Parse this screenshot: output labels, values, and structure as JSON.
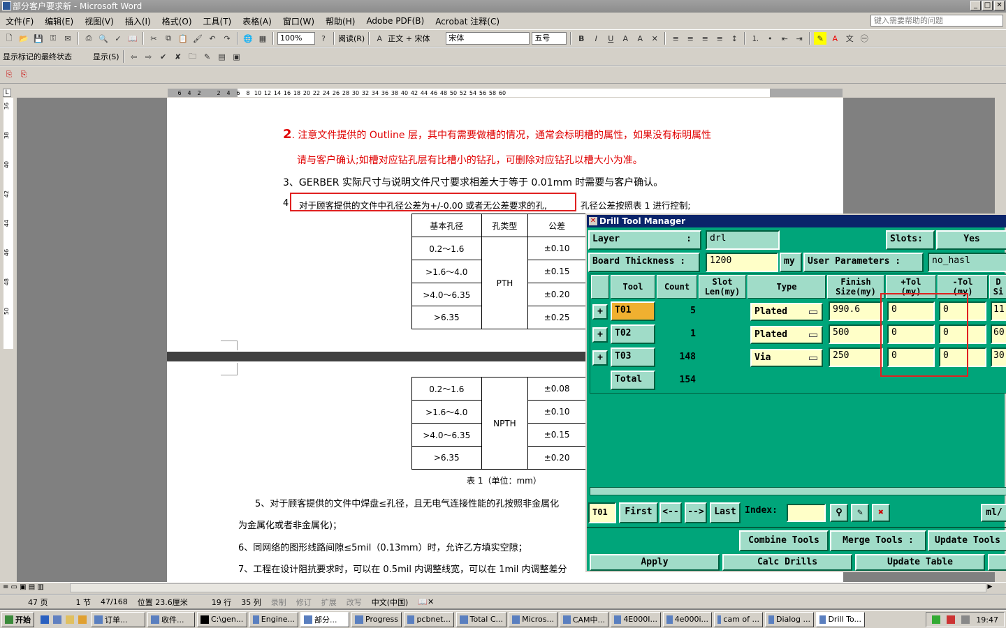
{
  "window": {
    "title": "部分客户要求新 - Microsoft Word"
  },
  "menu": [
    "文件(F)",
    "编辑(E)",
    "视图(V)",
    "插入(I)",
    "格式(O)",
    "工具(T)",
    "表格(A)",
    "窗口(W)",
    "帮助(H)",
    "Adobe PDF(B)",
    "Acrobat 注释(C)"
  ],
  "help_placeholder": "键入需要帮助的问题",
  "toolbar": {
    "zoom": "100%",
    "read_label": "阅读(R)",
    "style": "正文 + 宋体",
    "font": "宋体",
    "size": "五号"
  },
  "toolbar2": {
    "markup_state": "显示标记的最终状态",
    "show_label": "显示(S)"
  },
  "ruler": {
    "h_ticks": [
      "6",
      "4",
      "2",
      "",
      "2",
      "4",
      "6",
      "8",
      "10",
      "12",
      "14",
      "16",
      "18",
      "20",
      "22",
      "24",
      "26",
      "28",
      "30",
      "32",
      "34",
      "36",
      "38",
      "40",
      "42",
      "44",
      "46",
      "48",
      "50",
      "52",
      "54",
      "56",
      "58",
      "60"
    ],
    "v_ticks": [
      "36",
      "38",
      "40",
      "42",
      "44",
      "46",
      "48",
      "50"
    ]
  },
  "doc": {
    "item2_num": "2",
    "item2_line1": ". 注意文件提供的 Outline 层，其中有需要做槽的情况，通常会标明槽的属性，如果没有标明属性",
    "item2_line2": "请与客户确认;如槽对应钻孔层有比槽小的钻孔，可删除对应钻孔以槽大小为准。",
    "item3": "3、GERBER 实际尺寸与说明文件尺寸要求相差大于等于 0.01mm 时需要与客户确认。",
    "item4_num": "4",
    "item4_boxed": "对于顾客提供的文件中孔径公差为+/-0.00 或者无公差要求的孔,",
    "item4_rest": "孔径公差按照表 1 进行控制;",
    "table_headers": [
      "基本孔径",
      "孔类型",
      "公差"
    ],
    "pth_rows": [
      [
        "0.2～1.6",
        "±0.10"
      ],
      [
        ">1.6～4.0",
        "±0.15"
      ],
      [
        ">4.0～6.35",
        "±0.20"
      ],
      [
        ">6.35",
        "±0.25"
      ]
    ],
    "pth_label": "PTH",
    "npth_rows": [
      [
        "0.2～1.6",
        "±0.08"
      ],
      [
        ">1.6～4.0",
        "±0.10"
      ],
      [
        ">4.0～6.35",
        "±0.15"
      ],
      [
        ">6.35",
        "±0.20"
      ]
    ],
    "npth_label": "NPTH",
    "caption": "表 1（单位：mm）",
    "item5_line1": "5、对于顾客提供的文件中焊盘≤孔径，且无电气连接性能的孔按照非金属化",
    "item5_line2": "为金属化或者非金属化)；",
    "item6": "6、同网络的图形线路间隙≤5mil（0.13mm）时，允许乙方填实空隙；",
    "item7": "7、工程在设计阻抗要求时，可以在 0.5mil 内调整线宽，可以在 1mil 内调整差分"
  },
  "status": {
    "page": "47 页",
    "section": "1 节",
    "page_of": "47/168",
    "position": "位置 23.6厘米",
    "line": "19 行",
    "col": "35 列",
    "rec": "录制",
    "trk": "修订",
    "ext": "扩展",
    "ovr": "改写",
    "lang": "中文(中国)"
  },
  "taskbar": {
    "start": "开始",
    "items": [
      "订单...",
      "收件...",
      "C:\\gen...",
      "Engine...",
      "部分...",
      "Progress",
      "pcbnet...",
      "Total C...",
      "Micros...",
      "CAM中...",
      "4E000I...",
      "4e000i...",
      "cam of ...",
      "Dialog ...",
      "Drill To..."
    ],
    "clock": "19:47"
  },
  "dtm": {
    "title": "Drill Tool Manager",
    "layer_label": "Layer",
    "layer_sep": ":",
    "layer_value": "drl",
    "slots_label": "Slots:",
    "slots_value": "Yes",
    "thickness_label": "Board Thickness :",
    "thickness_value": "1200",
    "thickness_unit": "my",
    "user_params_label": "User Parameters :",
    "user_params_value": "no_hasl",
    "columns": [
      "Tool",
      "Count",
      "Slot\nLen(my)",
      "Type",
      "Finish\nSize(my)",
      "+Tol\n(my)",
      "-Tol\n(my)",
      "D\nSi"
    ],
    "rows": [
      {
        "tool": "T01",
        "count": "5",
        "type": "Plated",
        "finish": "990.6",
        "ptol": "0",
        "ntol": "0",
        "drill": "11"
      },
      {
        "tool": "T02",
        "count": "1",
        "type": "Plated",
        "finish": "500",
        "ptol": "0",
        "ntol": "0",
        "drill": "60"
      },
      {
        "tool": "T03",
        "count": "148",
        "type": "Via",
        "finish": "250",
        "ptol": "0",
        "ntol": "0",
        "drill": "30"
      }
    ],
    "total_label": "Total",
    "total_count": "154",
    "current_tool": "T01",
    "nav": {
      "first": "First",
      "prev": "<--",
      "next": "-->",
      "last": "Last",
      "index_label": "Index:",
      "unit_btn": "ml/"
    },
    "combine": "Combine Tools",
    "merge": "Merge Tools :",
    "update_tools": "Update Tools",
    "apply": "Apply",
    "calc": "Calc Drills",
    "update_table": "Update Table"
  }
}
